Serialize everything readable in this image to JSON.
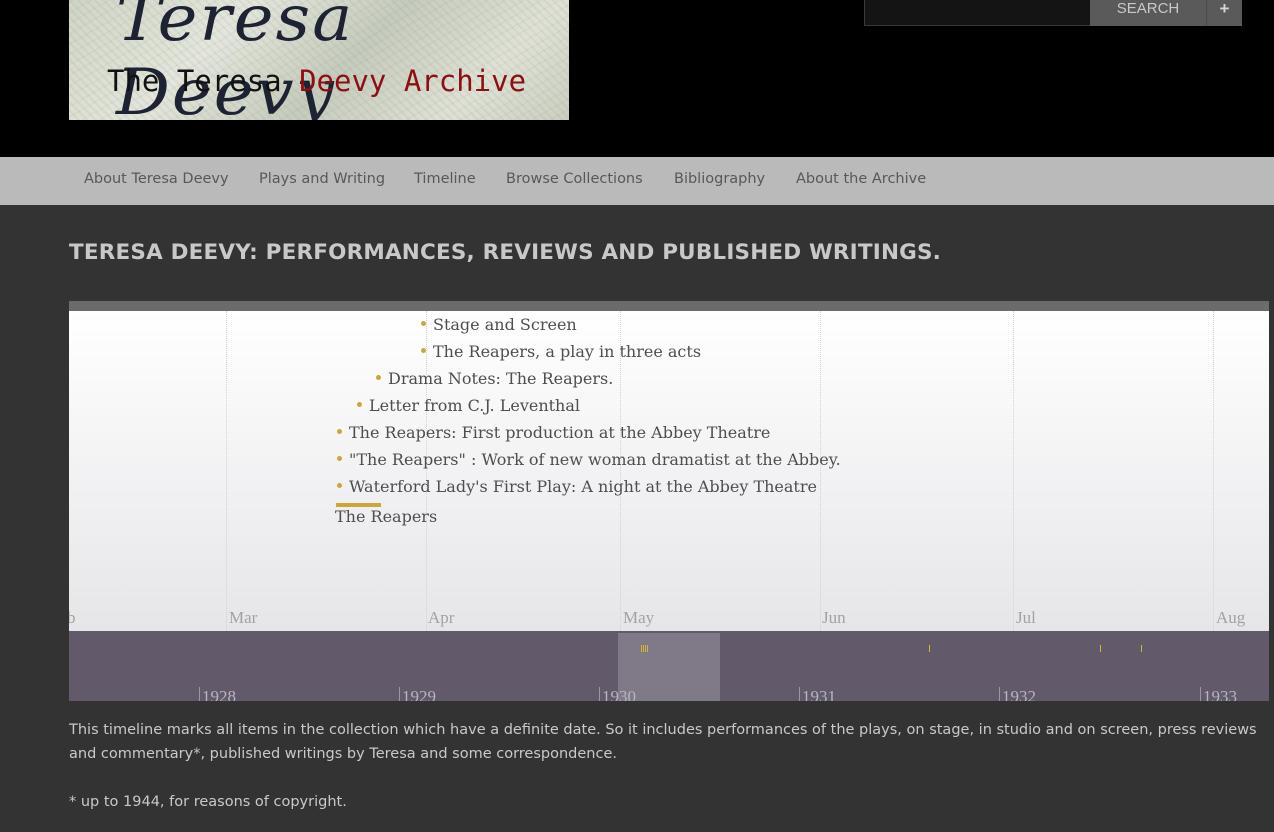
{
  "banner": {
    "signature_text": "Teresa Deevy",
    "title_plain": "The Teresa",
    "title_red": "Deevy Archive"
  },
  "search": {
    "placeholder": "",
    "button_label": "SEARCH",
    "advanced_label": "+"
  },
  "nav": {
    "items": [
      {
        "label": "About Teresa Deevy"
      },
      {
        "label": "Plays and Writing"
      },
      {
        "label": "Timeline"
      },
      {
        "label": "Browse Collections"
      },
      {
        "label": "Bibliography"
      },
      {
        "label": "About the Archive"
      }
    ]
  },
  "page_title": "TERESA DEEVY: PERFORMANCES, REVIEWS AND PUBLISHED WRITINGS.",
  "timeline": {
    "months": [
      "b",
      "Mar",
      "Apr",
      "May",
      "Jun",
      "Jul",
      "Aug"
    ],
    "events": [
      {
        "title": "Stage and Screen"
      },
      {
        "title": "The Reapers, a play in three acts"
      },
      {
        "title": "Drama Notes: The Reapers."
      },
      {
        "title": "Letter from C.J. Leventhal"
      },
      {
        "title": "The Reapers: First production at the Abbey Theatre"
      },
      {
        "title": "\"The Reapers\" : Work of new woman dramatist at the Abbey."
      },
      {
        "title": "Waterford Lady's First Play: A night at the Abbey Theatre"
      }
    ],
    "duration_event": {
      "title": "The Reapers"
    },
    "overview_years": [
      "1928",
      "1929",
      "1930",
      "1931",
      "1932",
      "1933"
    ],
    "accent_color": "#c9a640"
  },
  "description": {
    "paragraph": "This timeline marks all items in the collection which have a definite date. So it includes performances of the plays, on stage, in studio and on screen, press reviews and commentary*, published writings by Teresa and some correspondence.",
    "footnote": "* up to 1944, for reasons of copyright."
  }
}
